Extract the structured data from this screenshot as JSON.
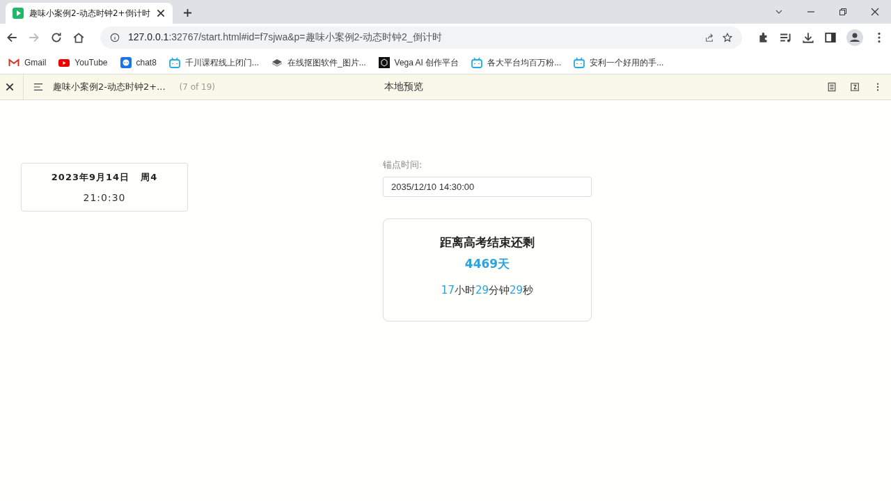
{
  "tab": {
    "title": "趣味小案例2-动态时钟2+倒计时"
  },
  "address": {
    "host": "127.0.0.1",
    "rest": ":32767/start.html#id=f7sjwa&p=趣味小案例2-动态时钟2_倒计时"
  },
  "bookmarks": [
    {
      "kind": "gmail",
      "label": "Gmail"
    },
    {
      "kind": "youtube",
      "label": "YouTube"
    },
    {
      "kind": "chat",
      "label": "chat8"
    },
    {
      "kind": "tv",
      "label": "千川课程线上闭门..."
    },
    {
      "kind": "layers",
      "label": "在线抠图软件_图片..."
    },
    {
      "kind": "vega",
      "label": "Vega AI 创作平台"
    },
    {
      "kind": "tv",
      "label": "各大平台均百万粉..."
    },
    {
      "kind": "tv",
      "label": "安利一个好用的手..."
    }
  ],
  "preview_bar": {
    "title": "趣味小案例2-动态时钟2+...",
    "count": "(7 of 19)",
    "center": "本地预览"
  },
  "clock": {
    "date": "2023年9月14日",
    "weekday": "周4",
    "time": "21:0:30"
  },
  "anchor": {
    "label": "锚点时间:",
    "value": "2035/12/10 14:30:00"
  },
  "countdown": {
    "heading": "距离高考结束还剩",
    "days": "4469天",
    "parts": [
      {
        "kind": "number",
        "text": "17"
      },
      {
        "kind": "unit",
        "text": "小时"
      },
      {
        "kind": "number",
        "text": "29"
      },
      {
        "kind": "unit",
        "text": "分钟"
      },
      {
        "kind": "number",
        "text": "29"
      },
      {
        "kind": "unit",
        "text": "秒"
      }
    ]
  }
}
